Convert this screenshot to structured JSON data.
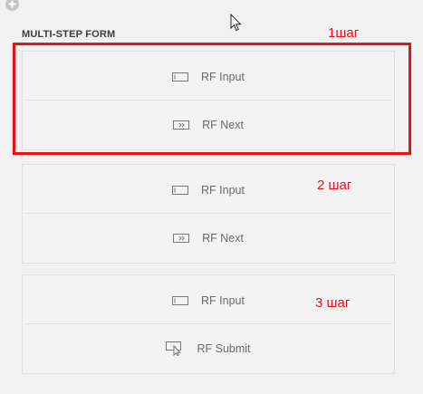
{
  "form": {
    "title": "MULTI-STEP FORM",
    "steps": [
      {
        "widgets": [
          {
            "label": "RF Input",
            "icon": "input-field-icon"
          },
          {
            "label": "RF Next",
            "icon": "next-arrow-icon"
          }
        ]
      },
      {
        "widgets": [
          {
            "label": "RF Input",
            "icon": "input-field-icon"
          },
          {
            "label": "RF Next",
            "icon": "next-arrow-icon"
          }
        ]
      },
      {
        "widgets": [
          {
            "label": "RF Input",
            "icon": "input-field-icon"
          },
          {
            "label": "RF Submit",
            "icon": "submit-pointer-icon"
          }
        ]
      }
    ]
  },
  "annotations": {
    "step1": "1шаг",
    "step2": "2 шаг",
    "step3": "3 шаг",
    "color": "#e8141b"
  },
  "colors": {
    "background": "#f1f1f1",
    "panel": "#f3f3f3",
    "border": "#e0e0e0",
    "text": "#6a6a6a"
  }
}
